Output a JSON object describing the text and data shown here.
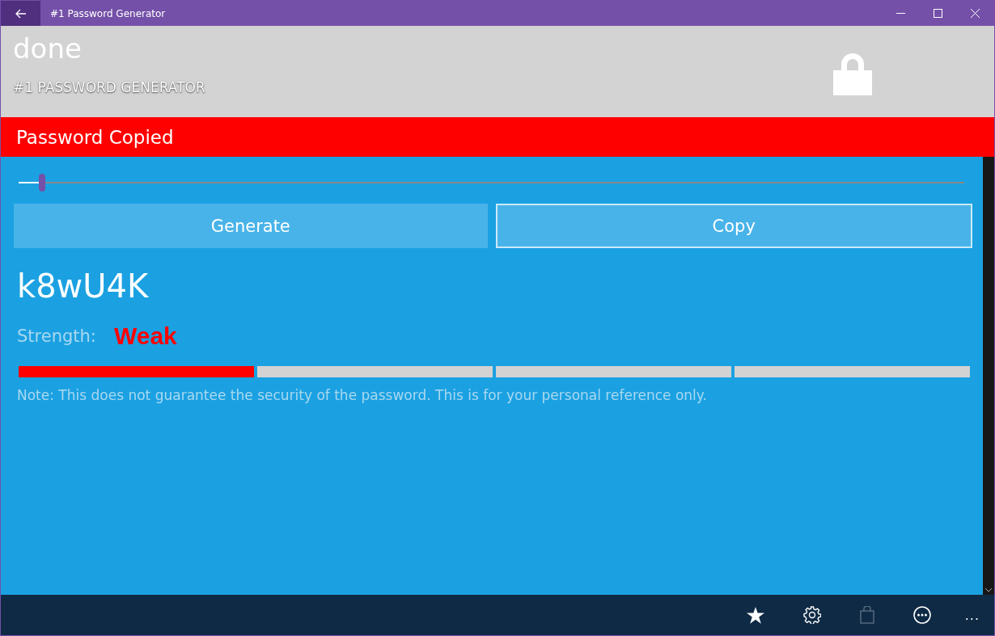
{
  "window": {
    "title": "#1 Password Generator"
  },
  "header": {
    "status": "done",
    "app_name": "#1 PASSWORD GENERATOR"
  },
  "banner": {
    "text": "Password Copied"
  },
  "length": {
    "level": 0.025
  },
  "buttons": [
    {
      "label": "Generate",
      "kind": "plain"
    },
    {
      "label": "Copy",
      "kind": "outlined"
    }
  ],
  "password": "k8wU4K",
  "strength": {
    "label": "Strength:",
    "value": "Weak",
    "color": "#ff0000"
  },
  "meter": [
    {
      "filled": true
    },
    {
      "filled": false
    },
    {
      "filled": false
    },
    {
      "filled": false
    }
  ],
  "note": "Note: This does not guarantee the security of the password. This is for your personal reference only.",
  "app_bar": [
    {
      "kind": "star",
      "disabled": false
    },
    {
      "kind": "gear",
      "disabled": false
    },
    {
      "kind": "bag",
      "disabled": true
    },
    {
      "kind": "more",
      "disabled": false
    }
  ],
  "overflow": "..."
}
